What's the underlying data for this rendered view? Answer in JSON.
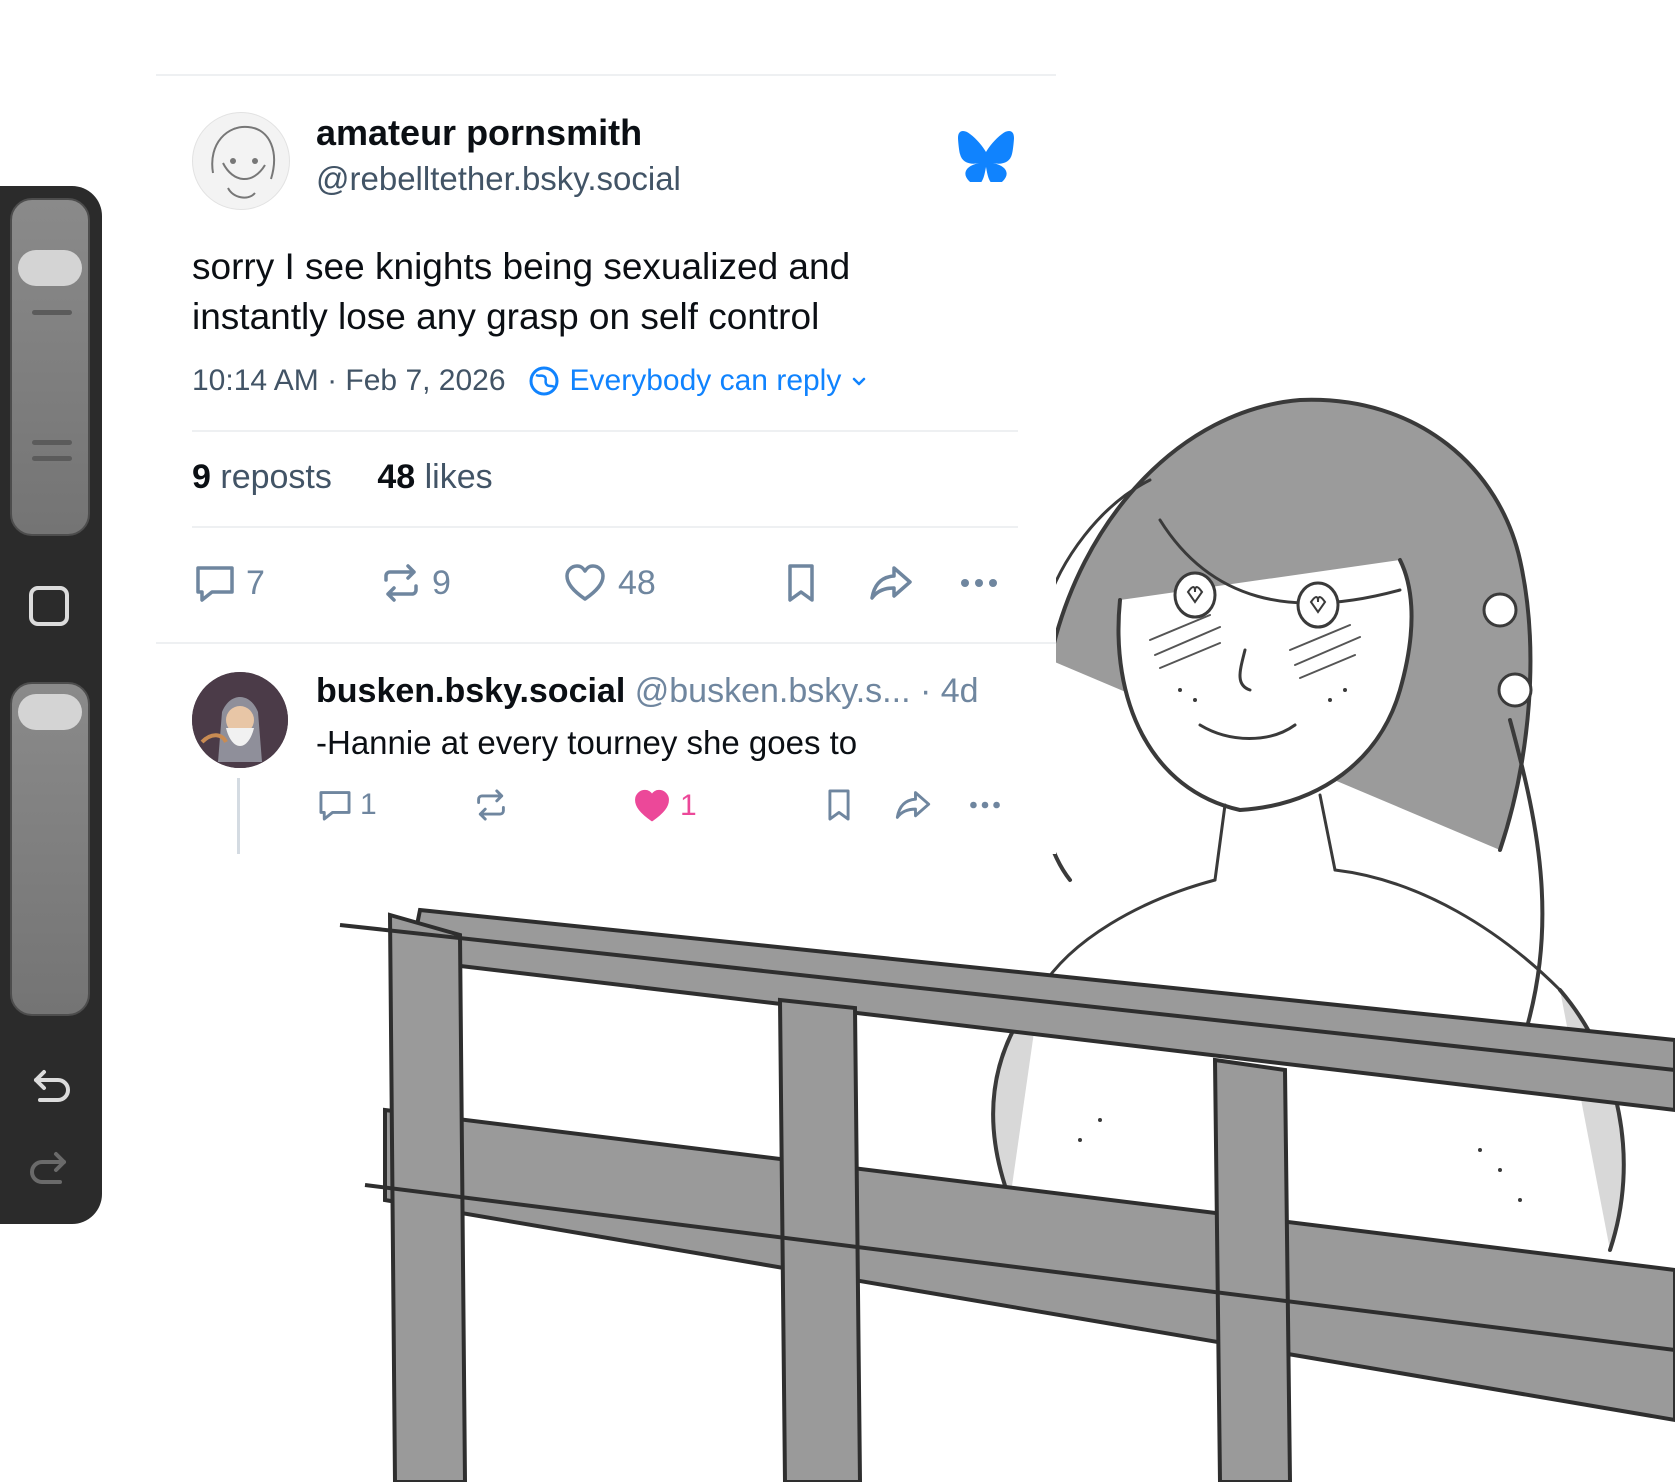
{
  "post": {
    "display_name": "amateur pornsmith",
    "handle": "@rebelltether.bsky.social",
    "text_line1": "sorry I see knights being sexualized and",
    "text_line2": "instantly lose any grasp on self control",
    "timestamp": "10:14 AM · Feb 7, 2026",
    "reply_setting": "Everybody can reply",
    "reposts_count": "9",
    "reposts_label": "reposts",
    "likes_count": "48",
    "likes_label": "likes",
    "actions": {
      "replies": "7",
      "reposts": "9",
      "likes": "48"
    },
    "brand_color": "#1083fe"
  },
  "reply": {
    "display_name": "busken.bsky.social",
    "handle": "@busken.bsky.s...",
    "age": "· 4d",
    "text": "-Hannie at every tourney she goes to",
    "actions": {
      "replies": "1",
      "reposts": "",
      "likes": "1"
    },
    "liked": true,
    "like_color": "#ec4899"
  },
  "icons": {
    "logo": "butterfly-icon",
    "reply": "speech-bubble-icon",
    "repost": "repost-arrows-icon",
    "like": "heart-icon",
    "bookmark": "bookmark-icon",
    "share": "share-arrow-icon",
    "more": "ellipsis-icon",
    "reply_setting": "globe-icon",
    "undo": "undo-icon",
    "redo": "redo-icon"
  }
}
